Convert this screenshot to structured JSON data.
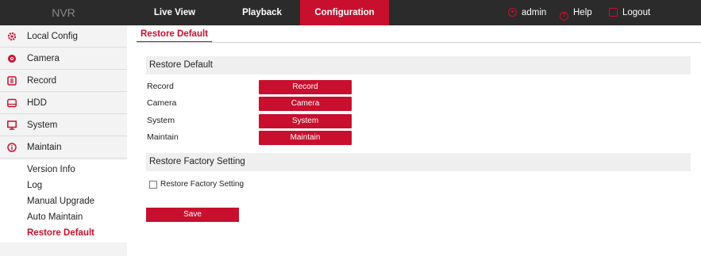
{
  "header": {
    "logo": "NVR",
    "nav": [
      "Live View",
      "Playback",
      "Configuration"
    ],
    "user": "admin",
    "help": "Help",
    "logout": "Logout",
    "accent_color": "#c8102e"
  },
  "sidebar": {
    "items": [
      {
        "label": "Local Config",
        "icon": "gear-icon"
      },
      {
        "label": "Camera",
        "icon": "camera-icon"
      },
      {
        "label": "Record",
        "icon": "record-icon"
      },
      {
        "label": "HDD",
        "icon": "hdd-icon"
      },
      {
        "label": "System",
        "icon": "monitor-icon"
      },
      {
        "label": "Maintain",
        "icon": "info-icon"
      }
    ],
    "sub_items": [
      "Version Info",
      "Log",
      "Manual Upgrade",
      "Auto Maintain",
      "Restore Default"
    ],
    "active_sub_item": "Restore Default"
  },
  "main": {
    "tab": "Restore Default",
    "section1_title": "Restore Default",
    "rows": [
      {
        "label": "Record",
        "button": "Record"
      },
      {
        "label": "Camera",
        "button": "Camera"
      },
      {
        "label": "System",
        "button": "System"
      },
      {
        "label": "Maintain",
        "button": "Maintain"
      }
    ],
    "section2_title": "Restore Factory Setting",
    "factory_checkbox_label": "Restore Factory Setting",
    "factory_checkbox_checked": false,
    "save_label": "Save"
  }
}
